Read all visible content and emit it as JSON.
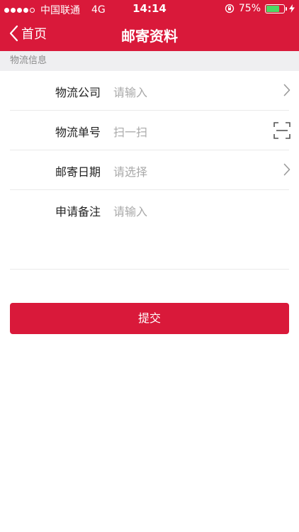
{
  "status_bar": {
    "carrier": "中国联通",
    "network": "4G",
    "time": "14:14",
    "battery_percent": "75%",
    "battery_level": 0.75,
    "signal_bars_filled": 4,
    "signal_bars_total": 5
  },
  "nav": {
    "back_label": "首页",
    "title": "邮寄资料"
  },
  "section": {
    "title": "物流信息"
  },
  "form": {
    "company": {
      "label": "物流公司",
      "placeholder": "请输入"
    },
    "tracking": {
      "label": "物流单号",
      "placeholder": "扫一扫"
    },
    "date": {
      "label": "邮寄日期",
      "placeholder": "请选择"
    },
    "remark": {
      "label": "申请备注",
      "placeholder": "请输入"
    }
  },
  "submit": {
    "label": "提交"
  },
  "colors": {
    "brand_red": "#d9193a",
    "section_bg": "#efeff1",
    "placeholder_gray": "#a9a9a9",
    "battery_green": "#4cd964"
  }
}
